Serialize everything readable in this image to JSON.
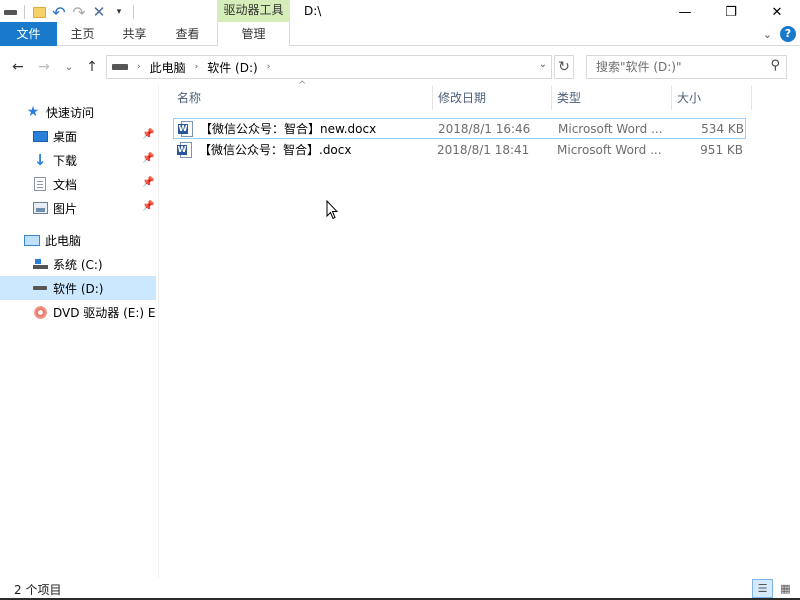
{
  "window": {
    "title": "D:\\",
    "context_tab_group": "驱动器工具",
    "controls": {
      "minimize": "—",
      "maximize": "❐",
      "close": "✕"
    }
  },
  "ribbon": {
    "tabs": [
      {
        "label": "文件"
      },
      {
        "label": "主页"
      },
      {
        "label": "共享"
      },
      {
        "label": "查看"
      },
      {
        "label": "管理"
      }
    ],
    "help": "?",
    "expand_chevron": "⌄"
  },
  "address": {
    "crumbs": [
      "此电脑",
      "软件 (D:)"
    ],
    "search_placeholder": "搜索\"软件 (D:)\""
  },
  "nav_pane": {
    "quick_access": "快速访问",
    "pinned": [
      {
        "label": "桌面",
        "icon": "desktop-icon"
      },
      {
        "label": "下载",
        "icon": "downloads-icon"
      },
      {
        "label": "文档",
        "icon": "documents-icon"
      },
      {
        "label": "图片",
        "icon": "pictures-icon"
      }
    ],
    "this_pc": "此电脑",
    "drives": [
      {
        "label": "系统 (C:)",
        "icon": "system-drive-icon"
      },
      {
        "label": "软件 (D:)",
        "icon": "drive-icon",
        "selected": true
      },
      {
        "label": "DVD 驱动器 (E:) EA",
        "icon": "dvd-drive-icon"
      }
    ]
  },
  "columns": [
    "名称",
    "修改日期",
    "类型",
    "大小"
  ],
  "files": [
    {
      "name": "【微信公众号：智合】new.docx",
      "modified": "2018/8/1 16:46",
      "type": "Microsoft Word ...",
      "size": "534 KB",
      "icon": "word-document-icon"
    },
    {
      "name": "【微信公众号：智合】.docx",
      "modified": "2018/8/1 18:41",
      "type": "Microsoft Word ...",
      "size": "951 KB",
      "icon": "word-document-icon"
    }
  ],
  "status": {
    "item_count": "2 个项目"
  },
  "colors": {
    "accent": "#1979ca",
    "context_tab": "#d5edb8",
    "selection": "#cce8ff",
    "hover_border": "#99d1ff"
  }
}
